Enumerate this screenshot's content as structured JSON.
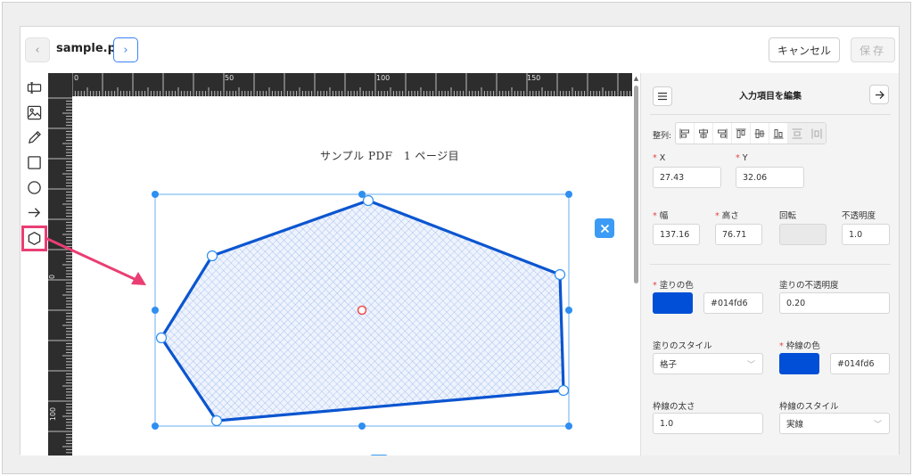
{
  "header": {
    "filename": "sample.pdf",
    "cancel_label": "キャンセル",
    "save_label": "保存",
    "prev_icon": "‹",
    "next_icon": "›"
  },
  "toolbar": {
    "tools": [
      "text-field-icon",
      "image-icon",
      "pencil-icon",
      "rectangle-icon",
      "ellipse-icon",
      "arrow-icon",
      "polygon-icon"
    ],
    "active_tool": "polygon-icon"
  },
  "ruler": {
    "top_labels": [
      "0",
      "50",
      "100",
      "150"
    ],
    "left_labels": [
      "0",
      "100"
    ]
  },
  "document": {
    "heading": "サンプル PDF　1 ページ目"
  },
  "panel": {
    "title": "入力項目を編集",
    "align_label": "整列:",
    "fields": {
      "x": {
        "label": "X",
        "value": "27.43",
        "required": true
      },
      "y": {
        "label": "Y",
        "value": "32.06",
        "required": true
      },
      "width": {
        "label": "幅",
        "value": "137.16",
        "required": true
      },
      "height": {
        "label": "高さ",
        "value": "76.71",
        "required": true
      },
      "rotation": {
        "label": "回転",
        "value": ""
      },
      "opacity": {
        "label": "不透明度",
        "value": "1.0"
      },
      "fill_color": {
        "label": "塗りの色",
        "value": "#014fd6",
        "required": true
      },
      "fill_opacity": {
        "label": "塗りの不透明度",
        "value": "0.20"
      },
      "fill_style": {
        "label": "塗りのスタイル",
        "value": "格子"
      },
      "stroke_color": {
        "label": "枠線の色",
        "value": "#014fd6",
        "required": true
      },
      "stroke_width": {
        "label": "枠線の太さ",
        "value": "1.0"
      },
      "stroke_style": {
        "label": "枠線のスタイル",
        "value": "実線"
      }
    }
  },
  "colors": {
    "accent": "#3b9bf5",
    "shape_stroke": "#0b55d0",
    "fill_swatch": "#014fd6",
    "annotation_arrow": "#ea3e73"
  }
}
